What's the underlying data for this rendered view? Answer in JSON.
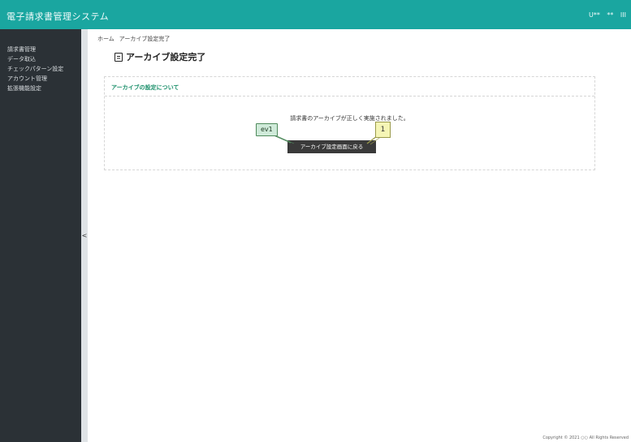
{
  "header": {
    "app_title": "電子請求書管理システム",
    "user_name": "U**",
    "user_suffix": "**",
    "menu_label": "III"
  },
  "sidebar": {
    "items": [
      {
        "label": "請求書管理"
      },
      {
        "label": "データ取込"
      },
      {
        "label": "チェックパターン設定"
      },
      {
        "label": "アカウント管理"
      },
      {
        "label": "拡張機能設定"
      }
    ],
    "collapse_glyph": "<"
  },
  "breadcrumb": {
    "home": "ホーム",
    "current": "アーカイブ設定完了"
  },
  "page": {
    "title": "アーカイブ設定完了"
  },
  "panel": {
    "header": "アーカイブの設定について",
    "message": "請求書のアーカイブが正しく実施されました。",
    "button_label": "アーカイブ設定画面に戻る"
  },
  "annotations": {
    "ev_label": "ev1",
    "number_label": "1"
  },
  "footer": {
    "copyright": "Copyright © 2021 ○○ All Rights Reserved"
  },
  "colors": {
    "header_bg": "#1aa6a0",
    "sidebar_bg": "#2b3136",
    "panel_title": "#1a8f6a",
    "button_bg": "#3a3a3a"
  }
}
